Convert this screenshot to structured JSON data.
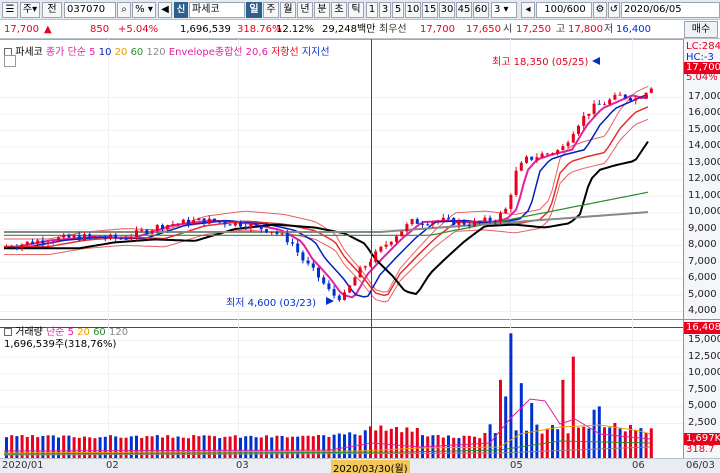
{
  "toolbar": {
    "menu_icon": "hamburger-icon",
    "type_label": "주",
    "all_label": "전",
    "code": "037070",
    "search_icon": "search-icon",
    "pct_label": "% ▾",
    "speaker_icon": "speaker-icon",
    "arrow_label": "◂▸",
    "sin_label": "신",
    "stock_name": "파세코",
    "periods": [
      "일",
      "주",
      "월",
      "년",
      "분",
      "초",
      "틱"
    ],
    "period_selected": 0,
    "intervals": [
      "1",
      "3",
      "5",
      "10",
      "15",
      "30",
      "45",
      "60"
    ],
    "interval_dropdown": "3",
    "count": "100/600",
    "date": "2020/06/05",
    "settings_icon": "gear-icon"
  },
  "quote": {
    "price": "17,700",
    "change_arrow": "▲",
    "change": "850",
    "change_pct": "+5.04%",
    "volume": "1,696,539",
    "volume_ratio": "318.76%",
    "turnover": "12.12%",
    "amount": "29,248백만",
    "best_label": "최우선",
    "best_ask": "17,700",
    "best_bid": "17,650",
    "open_label": "시",
    "open": "17,250",
    "high_label": "고",
    "high": "17,800",
    "low_label": "저",
    "low": "16,400",
    "buy_button": "매수"
  },
  "legend": {
    "price_name": "파세코",
    "ma_label": "종가 단순",
    "ma_periods": [
      "5",
      "10",
      "20",
      "60",
      "120"
    ],
    "envelope": "Envelope종합선 20,6",
    "trend": "저항선",
    "support": "지지선",
    "volume_name": "거래량",
    "volume_ma_label": "단순",
    "volume_ma_periods": [
      "5",
      "20",
      "60",
      "120"
    ],
    "volume_value": "1,696,539주(318,76%)"
  },
  "annotations": {
    "high": "최고 18,350 (05/25)",
    "low": "최저 4,600 (03/23)"
  },
  "price_axis": {
    "ticks": [
      "17,000",
      "16,000",
      "15,000",
      "14,000",
      "13,000",
      "12,000",
      "11,000",
      "10,000",
      "9,000",
      "8,000",
      "7,000",
      "6,000",
      "5,000",
      "4,000"
    ],
    "top_tag1": "LC:284",
    "top_tag2": "HC:-3",
    "current_tag": "17,700",
    "current_pct": "5.04%"
  },
  "volume_axis": {
    "ticks": [
      "15,000",
      "12,500",
      "10,000",
      "7,500",
      "5,000",
      "2,500"
    ],
    "top_tag": "16,408",
    "current_tag": "1,697K",
    "pct_tag": "318.7"
  },
  "date_axis": {
    "labels": [
      "2020/01",
      "02",
      "03",
      "2020/03/30(월)",
      "05",
      "06",
      "06/03"
    ]
  },
  "colors": {
    "up": "#e8001c",
    "down": "#0030d0",
    "ma5": "#e020a0",
    "ma10": "#0020c0",
    "ma20": "#e83030",
    "ma60": "#000000",
    "ma120": "#2e8b2e",
    "envelope": "#e86060",
    "crosshair": "#e8001c"
  }
}
